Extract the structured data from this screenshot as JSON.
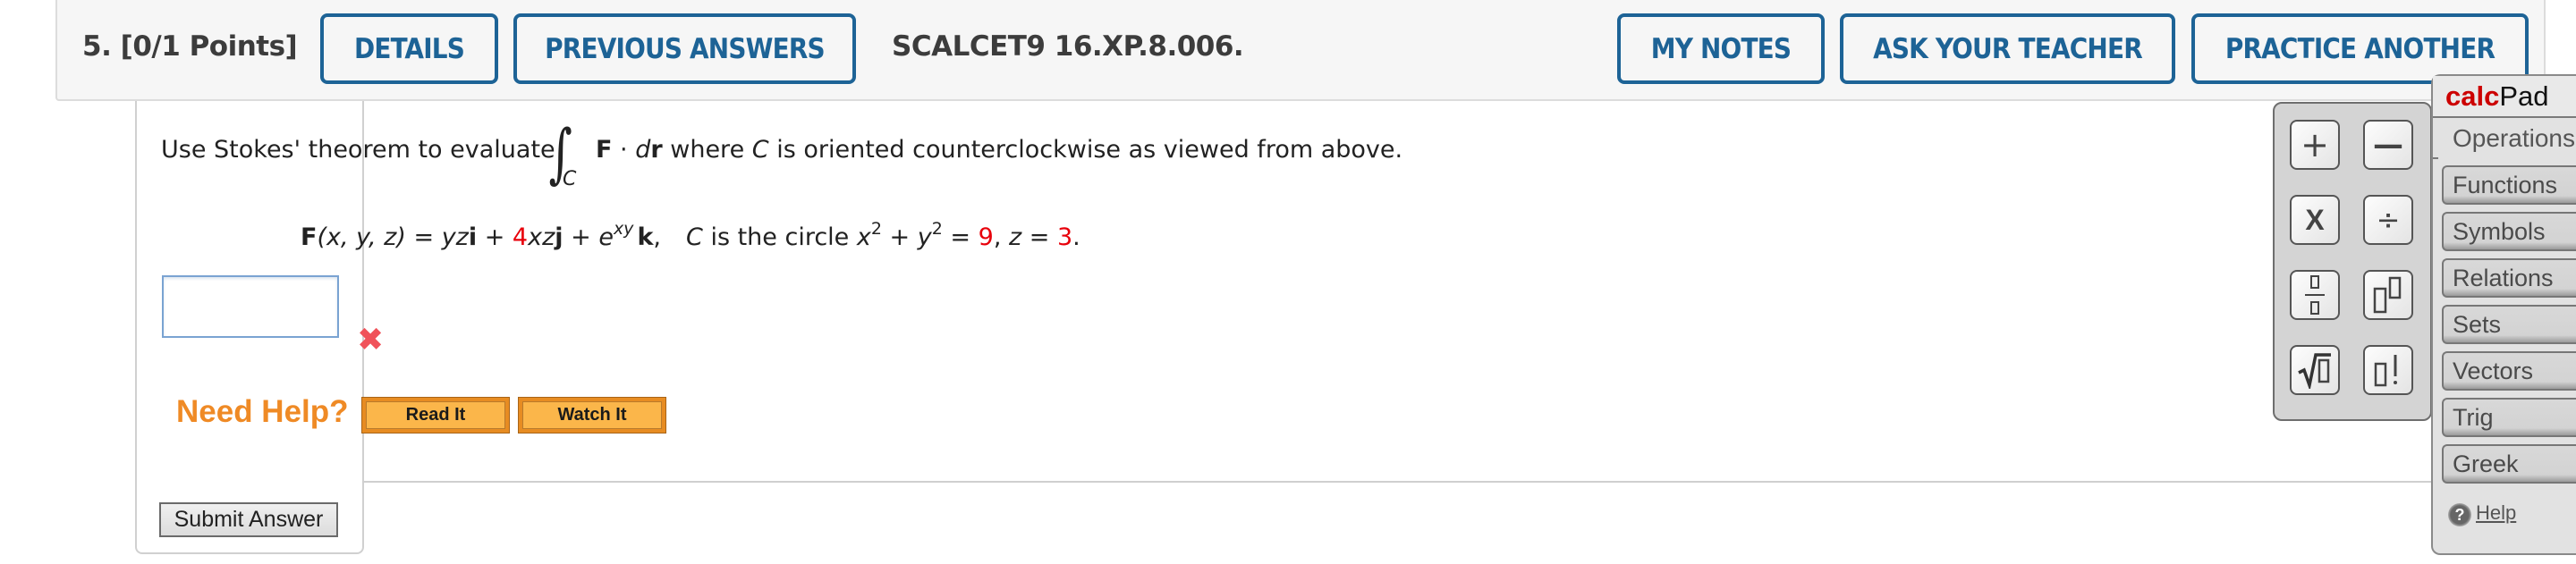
{
  "header": {
    "question_number": "5.",
    "points": "[0/1 Points]",
    "buttons": {
      "details": "DETAILS",
      "previous_answers": "PREVIOUS ANSWERS",
      "my_notes": "MY NOTES",
      "ask_teacher": "ASK YOUR TEACHER",
      "practice_another": "PRACTICE ANOTHER"
    },
    "problem_id": "SCALCET9 16.XP.8.006."
  },
  "question": {
    "prompt_before": "Use Stokes' theorem to evaluate",
    "integral_symbol": "∫",
    "integral_subscript": "C",
    "integrand_F": "F",
    "integrand_dot": " · ",
    "integrand_d": "d",
    "integrand_r": "r",
    "prompt_after_1": " where ",
    "prompt_C": "C",
    "prompt_after_2": " is oriented counterclockwise as viewed from above.",
    "field": {
      "F": "F",
      "args": "(x, y, z)",
      "eq": " = ",
      "term1": "yz",
      "i": "i",
      "plus1": " + ",
      "coef2": "4",
      "term2": "xz",
      "j": "j",
      "plus2": " + ",
      "e": "e",
      "exp": "xy",
      "k": "k",
      "comma": ",",
      "C": "C",
      "circle_text": " is the circle ",
      "x": "x",
      "sq": "2",
      "plus3": " + ",
      "y": "y",
      "eq2": " = ",
      "radius_sq": "9",
      "comma2": ", ",
      "z": "z",
      "eq3": " = ",
      "z_val": "3",
      "period": "."
    }
  },
  "answer": {
    "value": "",
    "status": "incorrect",
    "status_icon": "✖"
  },
  "help": {
    "label": "Need Help?",
    "read_it": "Read It",
    "watch_it": "Watch It"
  },
  "submit_label": "Submit Answer",
  "calcpad": {
    "title_calc": "calc",
    "title_pad": "Pad",
    "active_tab": "Operations",
    "keys": [
      "+",
      "—",
      "X",
      "÷",
      "fraction",
      "power",
      "sqrt",
      "factorial"
    ],
    "menu": [
      "Functions",
      "Symbols",
      "Relations",
      "Sets",
      "Vectors",
      "Trig",
      "Greek"
    ],
    "help_label": "Help",
    "help_icon": "?"
  },
  "colors": {
    "header_button": "#1d6396",
    "highlight_red": "#e8000b",
    "need_help_orange": "#ef8a25",
    "calcpad_red": "#cc0000"
  }
}
